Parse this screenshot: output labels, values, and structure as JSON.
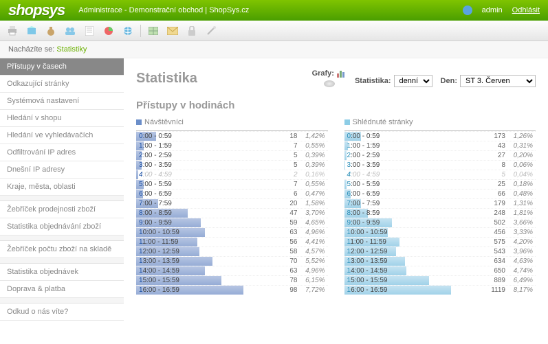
{
  "header": {
    "logo": "shopsys",
    "subtitle": "Administrace - Demonstrační obchod | ShopSys.cz",
    "user": "admin",
    "logout": "Odhlásit"
  },
  "breadcrumb": {
    "prefix": "Nacházíte se:",
    "current": "Statistiky"
  },
  "sidebar": {
    "groups": [
      [
        "Přístupy v časech",
        "Odkazující stránky",
        "Systémová nastavení",
        "Hledání v shopu",
        "Hledání ve vyhledávačích",
        "Odfiltrování IP adres",
        "Dnešní IP adresy",
        "Kraje, města, oblasti"
      ],
      [
        "Žebříček prodejnosti zboží",
        "Statistika objednávání zboží"
      ],
      [
        "Žebříček počtu zboží na skladě"
      ],
      [
        "Statistika objednávek",
        "Doprava & platba"
      ],
      [
        "Odkud o nás víte?"
      ]
    ],
    "active": "Přístupy v časech"
  },
  "page": {
    "title": "Statistika",
    "controls": {
      "graphs_label": "Grafy:",
      "stat_label": "Statistika:",
      "stat_options": [
        "denní"
      ],
      "day_label": "Den:",
      "day_options": [
        "ST 3. Červen"
      ]
    },
    "section_title": "Přístupy v hodinách",
    "left_title": "Návštěvníci",
    "right_title": "Shlédnuté stránky"
  },
  "chart_data": [
    {
      "type": "bar",
      "title": "Návštěvníci",
      "xlabel": "",
      "ylabel": "",
      "categories": [
        "0:00 - 0:59",
        "1:00 - 1:59",
        "2:00 - 2:59",
        "3:00 - 3:59",
        "4:00 - 4:59",
        "5:00 - 5:59",
        "6:00 - 6:59",
        "7:00 - 7:59",
        "8:00 - 8:59",
        "9:00 - 9:59",
        "10:00 - 10:59",
        "11:00 - 11:59",
        "12:00 - 12:59",
        "13:00 - 13:59",
        "14:00 - 14:59",
        "15:00 - 15:59",
        "16:00 - 16:59"
      ],
      "values": [
        18,
        7,
        5,
        5,
        2,
        7,
        6,
        20,
        47,
        59,
        63,
        56,
        58,
        70,
        63,
        78,
        98
      ],
      "percents": [
        "1,42%",
        "0,55%",
        "0,39%",
        "0,39%",
        "0,16%",
        "0,55%",
        "0,47%",
        "1,58%",
        "3,70%",
        "4,65%",
        "4,96%",
        "4,41%",
        "4,57%",
        "5,52%",
        "4,96%",
        "6,15%",
        "7,72%"
      ],
      "dim_index": 4
    },
    {
      "type": "bar",
      "title": "Shlédnuté stránky",
      "xlabel": "",
      "ylabel": "",
      "categories": [
        "0:00 - 0:59",
        "1:00 - 1:59",
        "2:00 - 2:59",
        "3:00 - 3:59",
        "4:00 - 4:59",
        "5:00 - 5:59",
        "6:00 - 6:59",
        "7:00 - 7:59",
        "8:00 - 8:59",
        "9:00 - 9:59",
        "10:00 - 10:59",
        "11:00 - 11:59",
        "12:00 - 12:59",
        "13:00 - 13:59",
        "14:00 - 14:59",
        "15:00 - 15:59",
        "16:00 - 16:59"
      ],
      "values": [
        173,
        43,
        27,
        8,
        5,
        25,
        66,
        179,
        248,
        502,
        456,
        575,
        543,
        634,
        650,
        889,
        1119
      ],
      "percents": [
        "1,26%",
        "0,31%",
        "0,20%",
        "0,06%",
        "0,04%",
        "0,18%",
        "0,48%",
        "1,31%",
        "1,81%",
        "3,66%",
        "3,33%",
        "4,20%",
        "3,96%",
        "4,63%",
        "4,74%",
        "6,49%",
        "8,17%"
      ],
      "dim_index": 4
    }
  ]
}
